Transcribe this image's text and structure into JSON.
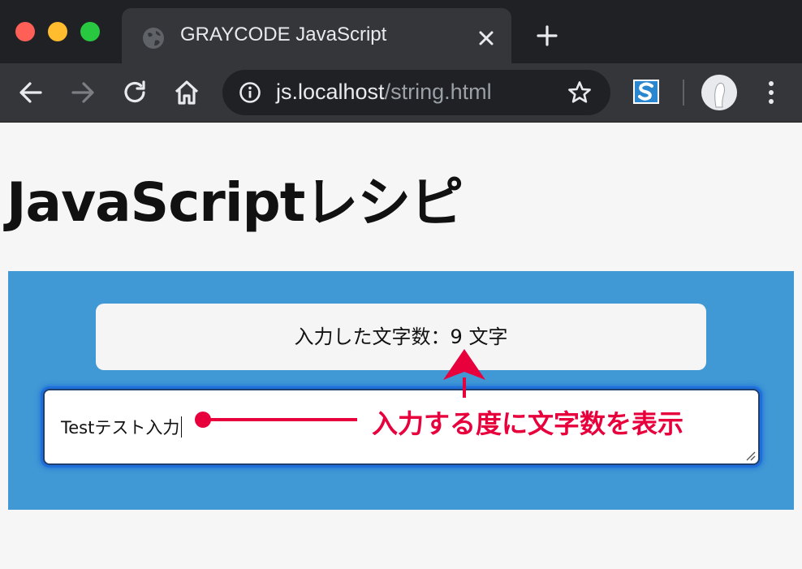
{
  "browser": {
    "tab_title": "GRAYCODE JavaScript",
    "url_host": "js.localhost",
    "url_path": "/string.html"
  },
  "page": {
    "title": "JavaScriptレシピ",
    "count_label": "入力した文字数：",
    "count_value": "9",
    "count_unit": " 文字",
    "textarea_value": "Testテスト入力"
  },
  "annotation": {
    "label": "入力する度に文字数を表示",
    "color": "#e8003d"
  },
  "colors": {
    "panel": "#4098d4",
    "chrome_dark": "#202124",
    "chrome": "#35363a",
    "focus_ring": "#1e6fd9"
  }
}
